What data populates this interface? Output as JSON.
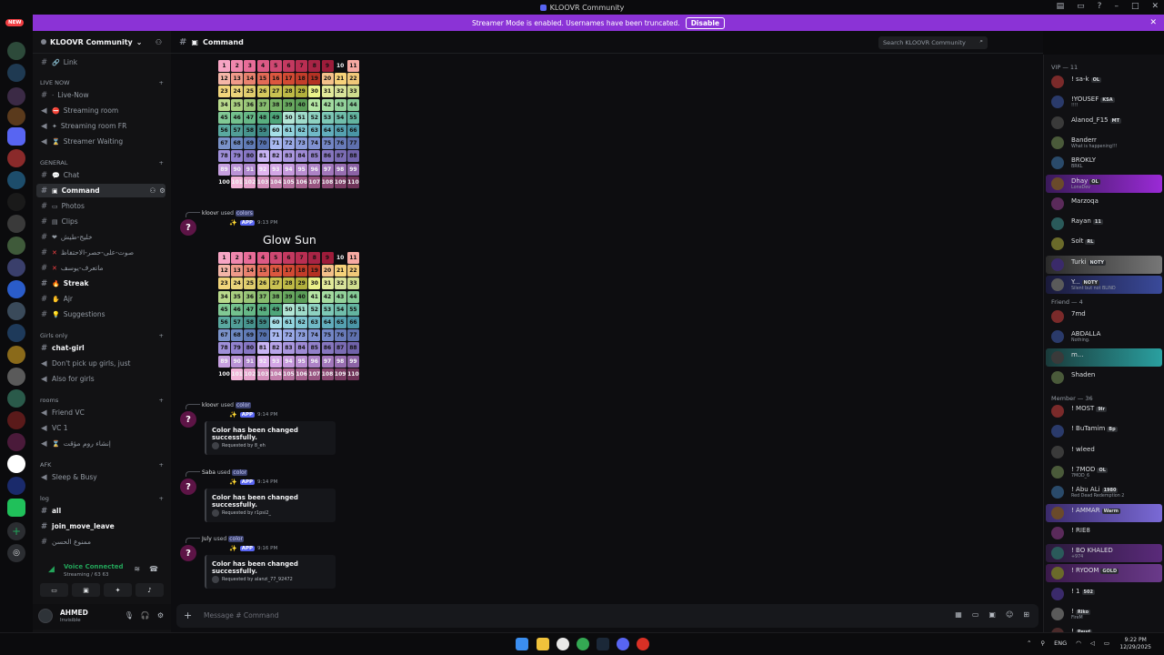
{
  "window": {
    "title": "KLOOVR Community"
  },
  "banner": {
    "text": "Streamer Mode is enabled. Usernames have been truncated.",
    "disable_label": "Disable"
  },
  "rail": {
    "new_badge": "NEW"
  },
  "server": {
    "name": "KLOOVR Community"
  },
  "categories": {
    "live": "LIVE NOW",
    "general": "GENERAL",
    "girls": "Girls only",
    "rooms": "rooms",
    "afk": "AFK",
    "log": "log"
  },
  "channels": {
    "link": "Link",
    "live_now": "Live-Now",
    "streaming": "Streaming room",
    "streaming_fr": "Streaming room FR",
    "waiting": "Streamer Waiting",
    "chat": "Chat",
    "command": "Command",
    "photos": "Photos",
    "clips": "Clips",
    "ar1": "خليج-طيش",
    "ar2": "صوت-على-حصر-الاحتفاظ",
    "ar3": "ماتعرف-يوسف",
    "streak": "Streak",
    "ajr": "Ajr",
    "suggestions": "Suggestions",
    "chat_girl": "chat-girl",
    "dont_pick": "Don't pick up girls, just",
    "also_girls": "Also for girls",
    "friend_vc": "Friend VC",
    "vc1": "VC 1",
    "create_room": "إنشاء روم مؤقت",
    "sleep": "Sleep & Busy",
    "all": "all",
    "join_move": "join_move_leave",
    "forbidden": "ممنوع الحسن"
  },
  "voice": {
    "status": "Voice Connected",
    "channel": "Streaming / 63 63"
  },
  "user": {
    "name": "AHMED",
    "status": "Invisible"
  },
  "chat": {
    "channel": "Command",
    "search_placeholder": "Search KLOOVR Community",
    "composer_placeholder": "Message # Command",
    "grid_numbers": [
      "1",
      "2",
      "3",
      "4",
      "5",
      "6",
      "7",
      "8",
      "9",
      "10",
      "11",
      "12",
      "13",
      "14",
      "15",
      "16",
      "17",
      "18",
      "19",
      "20",
      "21",
      "22",
      "23",
      "24",
      "25",
      "26",
      "27",
      "28",
      "29",
      "30",
      "31",
      "32",
      "33",
      "34",
      "35",
      "36",
      "37",
      "38",
      "39",
      "40",
      "41",
      "42",
      "43",
      "44",
      "45",
      "46",
      "47",
      "48",
      "49",
      "50",
      "51",
      "52",
      "53",
      "54",
      "55",
      "56",
      "57",
      "58",
      "59",
      "60",
      "61",
      "62",
      "63",
      "64",
      "65",
      "66",
      "67",
      "68",
      "69",
      "70",
      "71",
      "72",
      "73",
      "74",
      "75",
      "76",
      "77",
      "78",
      "79",
      "80",
      "81",
      "82",
      "83",
      "84",
      "85",
      "86",
      "87",
      "88",
      "89",
      "90",
      "91",
      "92",
      "93",
      "94",
      "95",
      "96",
      "97",
      "98",
      "99",
      "100",
      "101",
      "102",
      "103",
      "104",
      "105",
      "106",
      "107",
      "108",
      "109",
      "110"
    ],
    "messages": [
      {
        "user": "kloovr",
        "used": "used",
        "command": "colors",
        "app": "APP",
        "time": "9:13 PM",
        "heading": "Glow Sun"
      },
      {
        "user": "kloovr",
        "used": "used",
        "command": "color",
        "app": "APP",
        "time": "9:14 PM",
        "embed_title": "Color has been changed successfully.",
        "requested": "Requested by 8_eh"
      },
      {
        "user": "Saba",
        "used": "used",
        "command": "color",
        "app": "APP",
        "time": "9:14 PM",
        "embed_title": "Color has been changed successfully.",
        "requested": "Requested by r1psi2_"
      },
      {
        "user": "July",
        "used": "used",
        "command": "color",
        "app": "APP",
        "time": "9:16 PM",
        "embed_title": "Color has been changed successfully.",
        "requested": "Requested by alanzi_77_92472"
      }
    ]
  },
  "members": {
    "vip_header": "VIP — 11",
    "friend_header": "Friend — 4",
    "member_header": "Member — 36",
    "vip": [
      {
        "name": "! sa-k",
        "tag": "OL",
        "activity": ""
      },
      {
        "name": "!YOUSEF",
        "tag": "KSA",
        "activity": "!!!!"
      },
      {
        "name": "Alanod_F15",
        "tag": "MT",
        "activity": ""
      },
      {
        "name": "Banderr",
        "tag": "",
        "activity": "What is happening!!!"
      },
      {
        "name": "BROKLY",
        "tag": "",
        "activity": "BRKL"
      },
      {
        "name": "Dhay",
        "tag": "OL",
        "activity": "LoneDev"
      },
      {
        "name": "Marzoqa",
        "tag": "",
        "activity": ""
      },
      {
        "name": "Rayan",
        "tag": "11",
        "activity": ""
      },
      {
        "name": "Solt",
        "tag": "RL",
        "activity": ""
      },
      {
        "name": "Turki",
        "tag": "NOTY",
        "activity": ""
      },
      {
        "name": "Y...",
        "tag": "NOTY",
        "activity": "Silent but not BLIND"
      }
    ],
    "friends": [
      {
        "name": "7md",
        "tag": "",
        "activity": ""
      },
      {
        "name": "ABDALLA",
        "tag": "",
        "activity": "Nothing."
      },
      {
        "name": "m...",
        "tag": "",
        "activity": ""
      },
      {
        "name": "Shaden",
        "tag": "",
        "activity": ""
      }
    ],
    "members": [
      {
        "name": "! MOST",
        "tag": "9lr",
        "activity": ""
      },
      {
        "name": "! BuTamim",
        "tag": "Bp",
        "activity": ""
      },
      {
        "name": "! wleed",
        "tag": "",
        "activity": ""
      },
      {
        "name": "! 7MOD",
        "tag": "OL",
        "activity": "7MOD_6"
      },
      {
        "name": "! Abu ALi",
        "tag": "1980",
        "activity": "Red Dead Redemption 2"
      },
      {
        "name": "! AMMAR",
        "tag": "Warm",
        "activity": ""
      },
      {
        "name": "! RIE8",
        "tag": "",
        "activity": ""
      },
      {
        "name": "! BO KHALED",
        "tag": "",
        "activity": "+974"
      },
      {
        "name": "! RYOOM",
        "tag": "GOLD",
        "activity": ""
      },
      {
        "name": "! 1",
        "tag": "502",
        "activity": ""
      },
      {
        "name": "!",
        "tag": "Riko",
        "activity": "FireM"
      },
      {
        "name": "!",
        "tag": "Peud",
        "activity": ""
      }
    ]
  },
  "taskbar": {
    "lang": "ENG",
    "time": "9:22 PM",
    "date": "12/29/2025"
  }
}
